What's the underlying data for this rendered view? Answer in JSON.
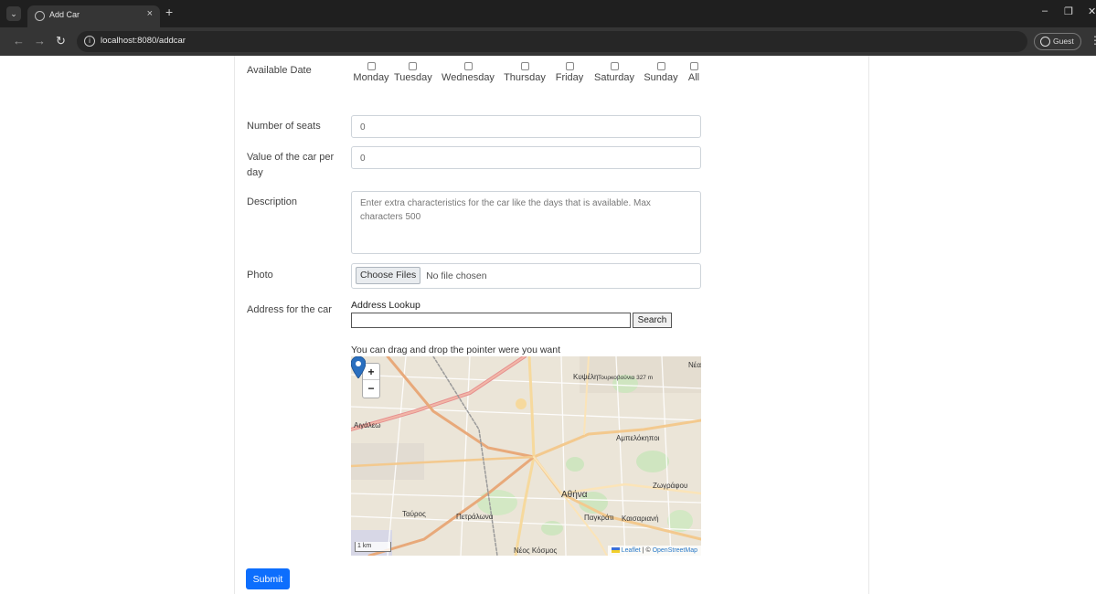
{
  "browser": {
    "tab_title": "Add Car",
    "url": "localhost:8080/addcar",
    "guest_label": "Guest",
    "new_tab_label": "+",
    "close_tab_label": "×"
  },
  "form": {
    "available_date_label": "Available Date",
    "days": [
      "Monday",
      "Tuesday",
      "Wednesday",
      "Thursday",
      "Friday",
      "Saturday",
      "Sunday",
      "All"
    ],
    "seats_label": "Number of seats",
    "seats_value": "0",
    "value_label": "Value of the car per day",
    "value_value": "0",
    "description_label": "Description",
    "description_placeholder": "Enter extra characteristics for the car like the days that is available. Max characters 500",
    "photo_label": "Photo",
    "choose_files_label": "Choose Files",
    "no_file_label": "No file chosen",
    "address_label": "Address for the car",
    "address_lookup_title": "Address Lookup",
    "address_lookup_value": "",
    "search_label": "Search",
    "drag_hint": "You can drag and drop the pointer were you want",
    "submit_label": "Submit"
  },
  "map": {
    "zoom_in": "+",
    "zoom_out": "−",
    "scale_label": "1 km",
    "attribution_leaflet": "Leaflet",
    "attribution_sep": "| ©",
    "attribution_osm": "OpenStreetMap",
    "place_labels": [
      "Κυψέλη",
      "Τουρκοβούνια 327 m",
      "Αιγάλεω",
      "Αμπελόκηποι",
      "Ζωγράφου",
      "Αθήνα",
      "Ταύρος",
      "Πετράλωνα",
      "Παγκράτι",
      "Καισαριανή",
      "Νέος Κόσμος",
      "Νέα"
    ]
  },
  "colors": {
    "submit_bg": "#0d6efd",
    "map_bg": "#ece6da",
    "marker": "#2a6fbf"
  }
}
